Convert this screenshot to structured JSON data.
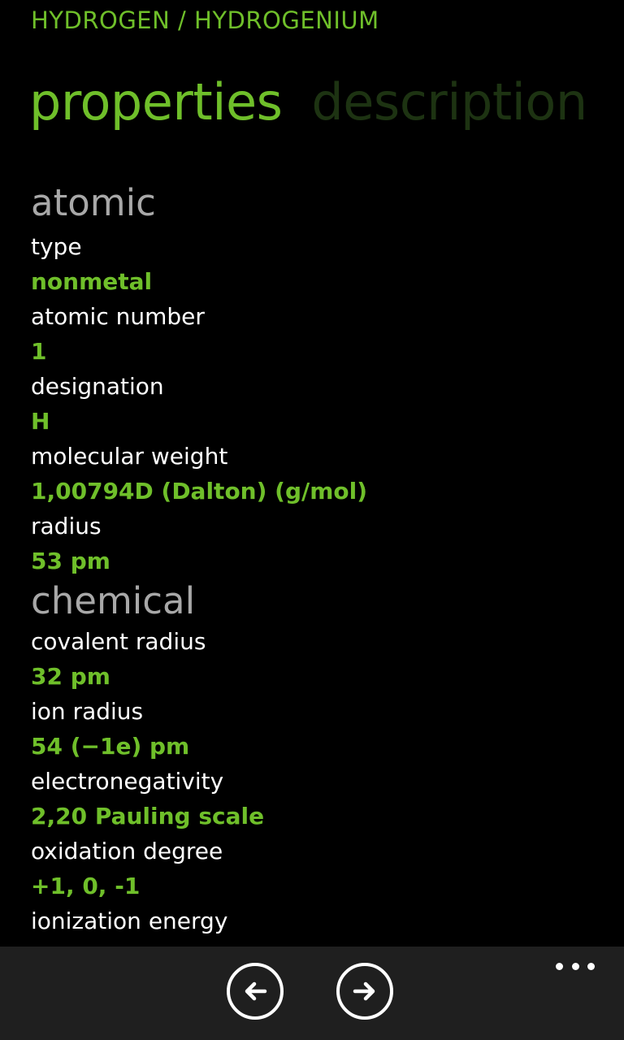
{
  "header": {
    "title": "HYDROGEN / HYDROGENIUM"
  },
  "pivot": {
    "tabs": [
      {
        "label": "properties",
        "active": true
      },
      {
        "label": "description",
        "active": false
      }
    ]
  },
  "sections": {
    "atomic": {
      "title": "atomic",
      "items": [
        {
          "label": "type",
          "value": "nonmetal"
        },
        {
          "label": "atomic number",
          "value": "1"
        },
        {
          "label": "designation",
          "value": "H"
        },
        {
          "label": "molecular weight",
          "value": "1,00794D (Dalton) (g/mol)"
        },
        {
          "label": "radius",
          "value": "53 pm"
        }
      ]
    },
    "chemical": {
      "title": "chemical",
      "items": [
        {
          "label": "covalent radius",
          "value": "32 pm"
        },
        {
          "label": "ion radius",
          "value": "54 (−1e) pm"
        },
        {
          "label": "electronegativity",
          "value": "2,20 Pauling scale"
        },
        {
          "label": "oxidation degree",
          "value": "+1, 0, -1"
        },
        {
          "label": "ionization energy",
          "value": ""
        }
      ]
    }
  },
  "app_bar": {
    "buttons": [
      {
        "icon": "arrow-left-icon"
      },
      {
        "icon": "arrow-right-icon"
      }
    ],
    "more_icon": "ellipsis-icon"
  },
  "colors": {
    "accent": "#6fbf2a",
    "inactive_tab": "#1d3312",
    "section_header": "#a8a8a8",
    "background": "#000000",
    "app_bar": "#1f1f1f"
  }
}
